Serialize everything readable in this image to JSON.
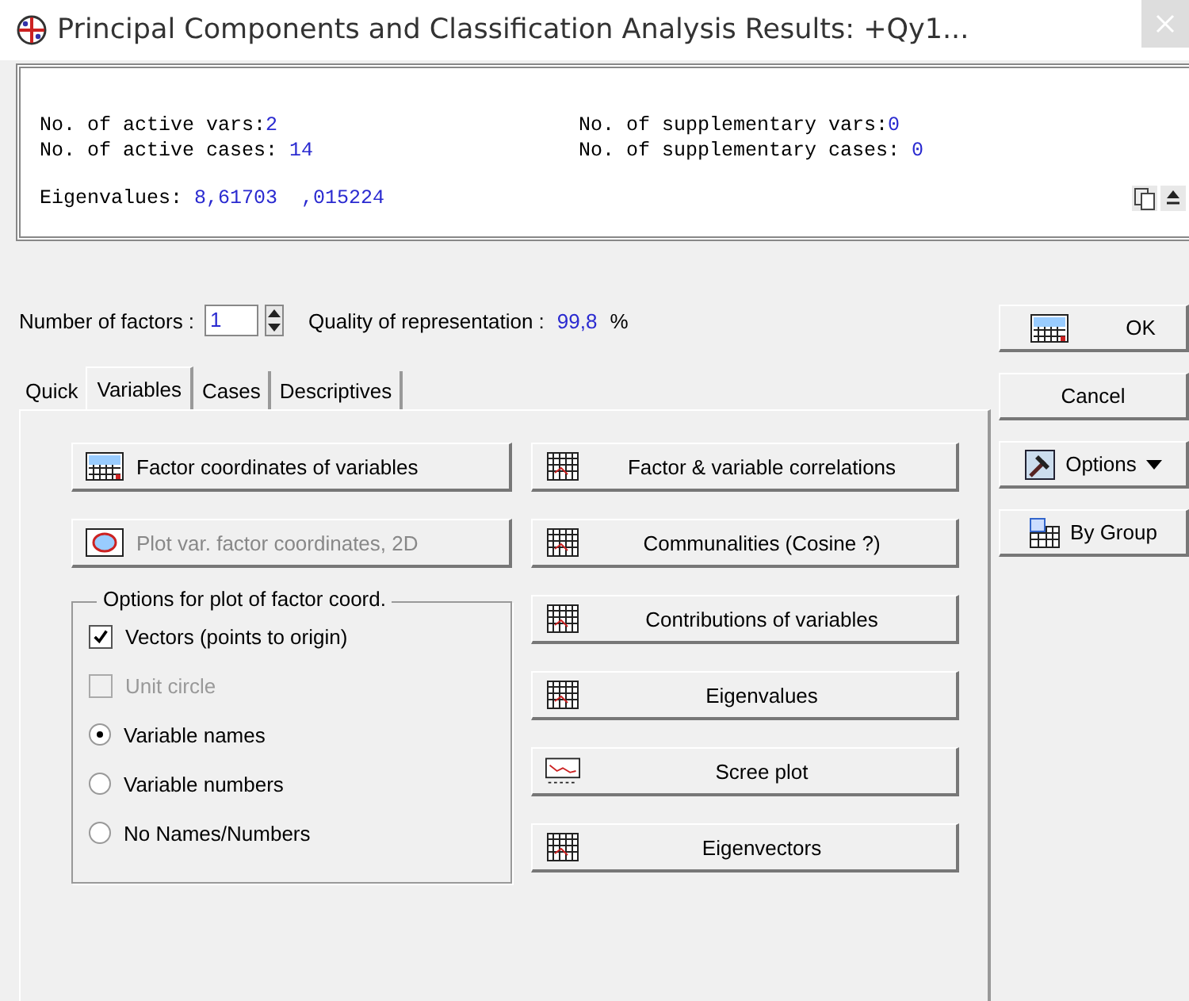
{
  "window": {
    "title": "Principal Components and Classification Analysis Results: +Qy1..."
  },
  "summary": {
    "lines": [
      {
        "left_label": "No. of active vars:",
        "left_value": "2",
        "right_label": "No. of supplementary vars:",
        "right_value": "0"
      },
      {
        "left_label": "No. of active cases: ",
        "left_value": "14",
        "right_label": "No. of supplementary cases: ",
        "right_value": "0"
      }
    ],
    "eigen_label": "Eigenvalues: ",
    "eigen_values": "8,61703  ,015224"
  },
  "factors": {
    "label": "Number of factors :",
    "value": "1",
    "quality_label": "Quality of representation :",
    "quality_value": "99,8",
    "quality_unit": "%"
  },
  "tabs": [
    {
      "label": "Quick",
      "selected": false
    },
    {
      "label": "Variables",
      "selected": true
    },
    {
      "label": "Cases",
      "selected": false
    },
    {
      "label": "Descriptives",
      "selected": false
    }
  ],
  "left_buttons": [
    {
      "label": "Factor coordinates of variables",
      "kind": "summary",
      "disabled": false
    },
    {
      "label": "Plot var. factor coordinates, 2D",
      "kind": "plot",
      "disabled": true
    }
  ],
  "options_group": {
    "title": "Options for plot of factor coord.",
    "items": [
      {
        "kind": "checkbox",
        "label": "Vectors (points to origin)",
        "checked": true,
        "disabled": false
      },
      {
        "kind": "checkbox",
        "label": "Unit circle",
        "checked": false,
        "disabled": true
      },
      {
        "kind": "radio",
        "label": "Variable names",
        "selected": true
      },
      {
        "kind": "radio",
        "label": "Variable numbers",
        "selected": false
      },
      {
        "kind": "radio",
        "label": "No Names/Numbers",
        "selected": false
      }
    ]
  },
  "right_buttons": [
    {
      "label": "Factor & variable correlations",
      "kind": "table"
    },
    {
      "label": "Communalities (Cosine ?)",
      "kind": "table"
    },
    {
      "label": "Contributions of variables",
      "kind": "table"
    },
    {
      "label": "Eigenvalues",
      "kind": "table"
    },
    {
      "label": "Scree plot",
      "kind": "chart"
    },
    {
      "label": "Eigenvectors",
      "kind": "table"
    }
  ],
  "side_buttons": [
    {
      "label": "OK",
      "kind": "summary"
    },
    {
      "label": "Cancel",
      "kind": "plain"
    },
    {
      "label": "Options",
      "kind": "menu"
    },
    {
      "label": "By Group",
      "kind": "group"
    }
  ]
}
